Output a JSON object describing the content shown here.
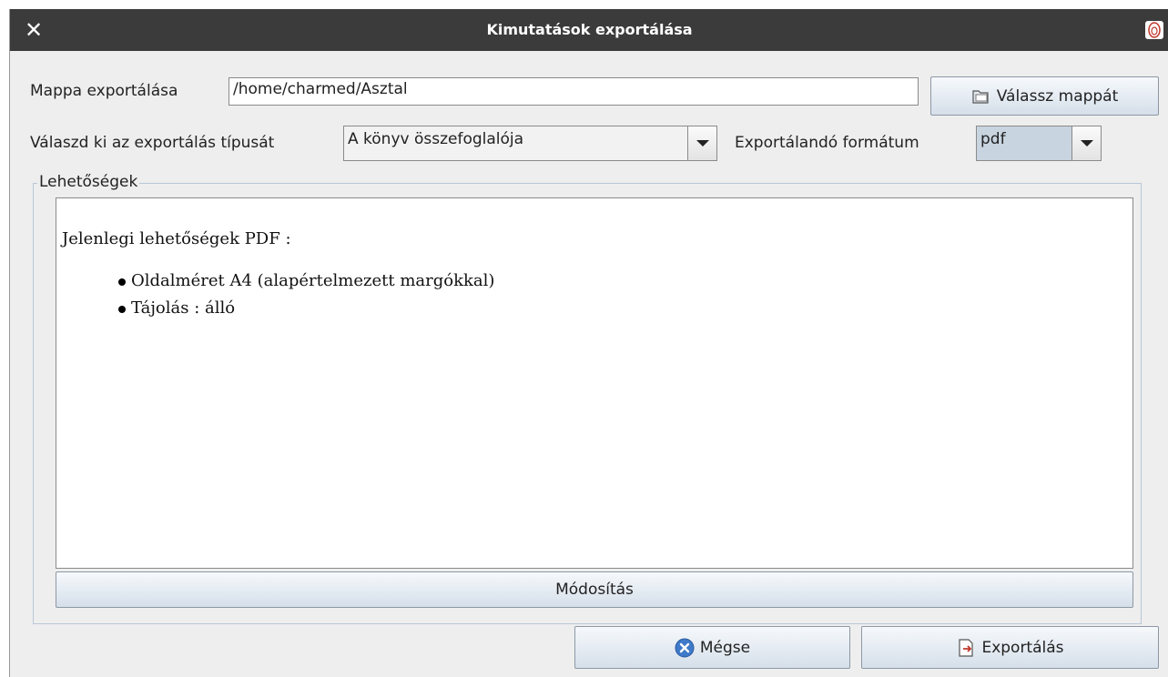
{
  "window": {
    "title": "Kimutatások exportálása"
  },
  "export_folder": {
    "label": "Mappa exportálása",
    "value": "/home/charmed/Asztal",
    "choose_button": "Válassz mappát"
  },
  "export_type": {
    "label": "Válaszd ki az exportálás típusát",
    "selected": "A könyv összefoglalója"
  },
  "export_format": {
    "label": "Exportálandó formátum",
    "selected": "pdf"
  },
  "options": {
    "legend": "Lehetőségek",
    "heading": "Jelenlegi lehetőségek PDF :",
    "items": [
      "Oldalméret A4 (alapértelmezett margókkal)",
      "Tájolás : álló"
    ],
    "modify_button": "Módosítás"
  },
  "footer": {
    "cancel_button": "Mégse",
    "export_button": "Exportálás"
  },
  "icons": {
    "close": "close-icon",
    "app": "app-icon",
    "folder": "folder-icon",
    "cancel": "cancel-icon",
    "export": "export-icon"
  },
  "colors": {
    "titlebar": "#3b3b3b",
    "dialog_bg": "#eeeeee",
    "button_gradient_top": "#f6f9fc",
    "button_gradient_bottom": "#d5dfea",
    "cancel_icon": "#3f79c9"
  }
}
